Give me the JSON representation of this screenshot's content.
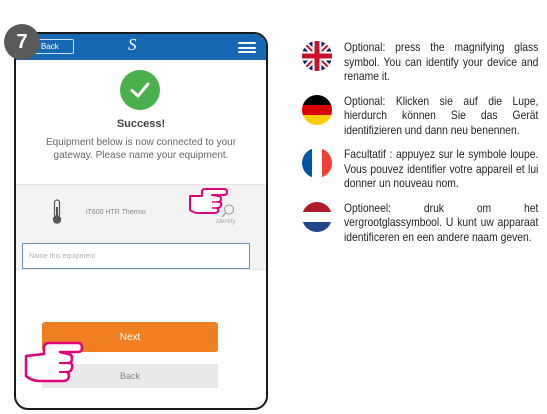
{
  "step": {
    "number": "7"
  },
  "app": {
    "header": {
      "back_label": "Back",
      "logo_icon": "salus-s-logo-icon",
      "menu_icon": "hamburger-menu-icon"
    },
    "success": {
      "title": "Success!",
      "message": "Equipment below is now connected to your gateway. Please name your equipment."
    },
    "equipment": {
      "name": "iT600 HTR Thermo",
      "identify_label": "Identify"
    },
    "name_input": {
      "placeholder": "Name this equipment",
      "value": ""
    },
    "buttons": {
      "next_label": "Next",
      "back_label": "Back"
    },
    "colors": {
      "header": "#1668b4",
      "next_button": "#f07f22",
      "success": "#4ab04b"
    }
  },
  "instructions": [
    {
      "flag": "uk-flag-icon",
      "text": "Optional: press the magnifying glass symbol. You can identify your device and rename it."
    },
    {
      "flag": "de-flag-icon",
      "text": "Optional: Klicken sie auf die Lupe, hierdurch können Sie das Gerät identifizieren und dann neu benennen."
    },
    {
      "flag": "fr-flag-icon",
      "text": "Facultatif : appuyez sur le symbole loupe. Vous pouvez identifier votre appareil et lui donner un nouveau nom."
    },
    {
      "flag": "nl-flag-icon",
      "text": "Optioneel: druk om het vergrootglassymbool. U kunt uw apparaat identificeren en een andere naam geven."
    }
  ]
}
